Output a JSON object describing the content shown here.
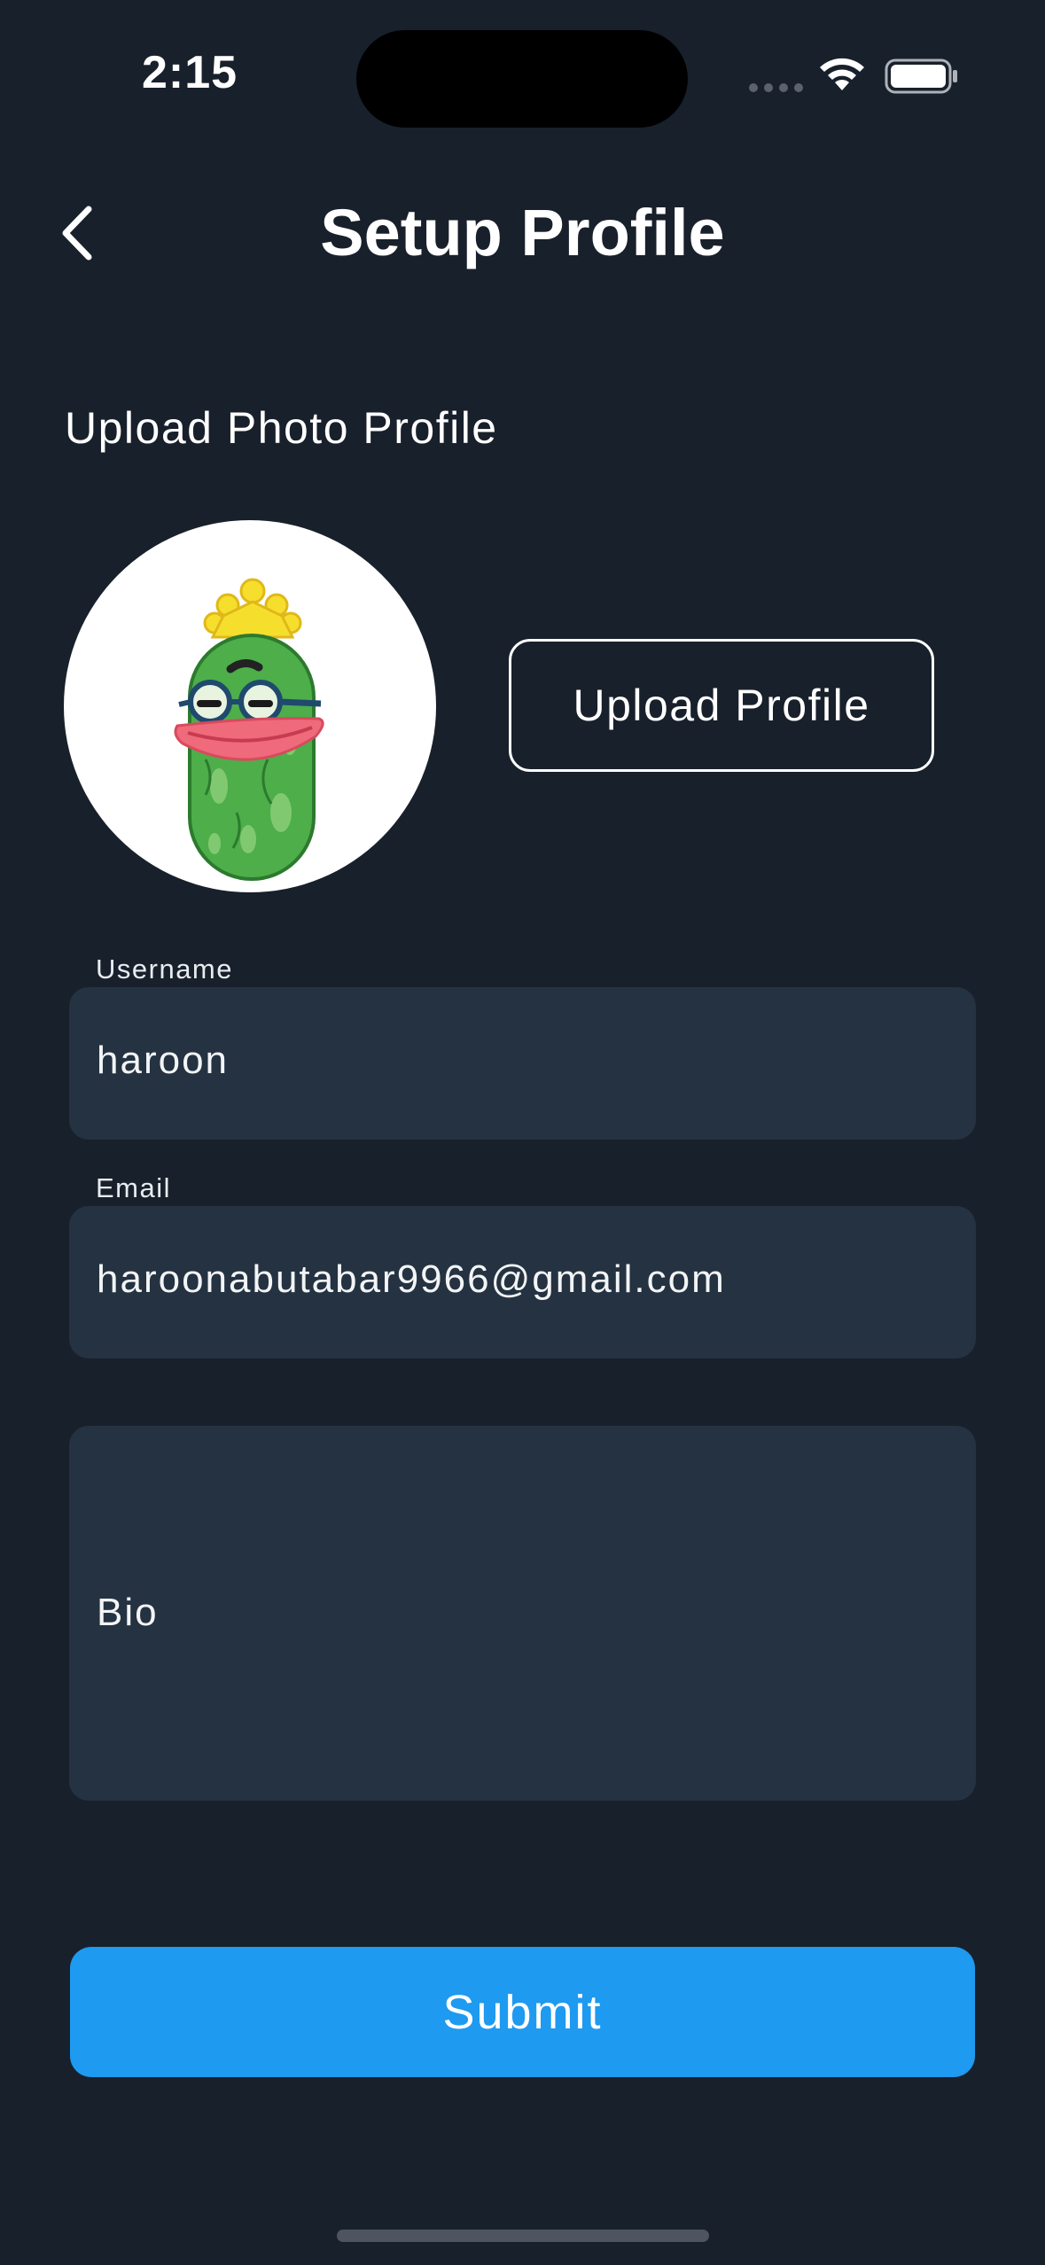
{
  "status_bar": {
    "time": "2:15"
  },
  "header": {
    "title": "Setup Profile",
    "back_icon": "chevron-left-icon"
  },
  "photo_section": {
    "label": "Upload Photo Profile",
    "upload_button_label": "Upload Profile",
    "avatar_description": "cartoon-cucumber-avatar"
  },
  "form": {
    "username": {
      "label": "Username",
      "value": "haroon"
    },
    "email": {
      "label": "Email",
      "value": "haroonabutabar9966@gmail.com"
    },
    "bio": {
      "placeholder": "Bio"
    }
  },
  "submit": {
    "label": "Submit"
  },
  "colors": {
    "background": "#18202b",
    "field_background": "#243241",
    "accent": "#1e9af0"
  }
}
